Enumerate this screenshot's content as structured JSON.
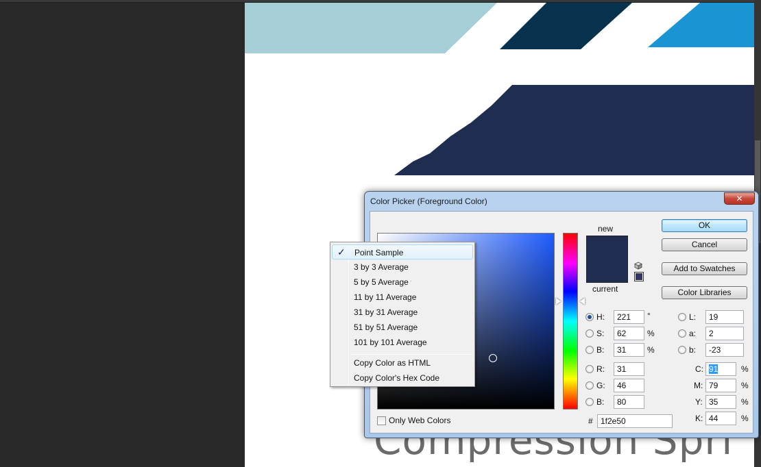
{
  "canvas": {
    "background_text": "Compression  Spri",
    "colors": {
      "light_teal": "#a6ced6",
      "dark_teal": "#06324e",
      "bright_blue": "#1a94d2",
      "navy": "#1f2e50"
    }
  },
  "dialog": {
    "title": "Color Picker (Foreground Color)",
    "close_glyph": "✕",
    "new_label": "new",
    "current_label": "current",
    "swatch_color": "#1f2e50",
    "buttons": {
      "ok": "OK",
      "cancel": "Cancel",
      "add_to_swatches": "Add to Swatches",
      "color_libraries": "Color Libraries"
    },
    "hsb": {
      "h_label": "H:",
      "h_value": "221",
      "h_unit": "°",
      "s_label": "S:",
      "s_value": "62",
      "s_unit": "%",
      "b_label": "B:",
      "b_value": "31",
      "b_unit": "%"
    },
    "rgb": {
      "r_label": "R:",
      "r_value": "31",
      "g_label": "G:",
      "g_value": "46",
      "b_label": "B:",
      "b_value": "80"
    },
    "lab": {
      "l_label": "L:",
      "l_value": "19",
      "a_label": "a:",
      "a_value": "2",
      "b_label": "b:",
      "b_value": "-23"
    },
    "cmyk": {
      "c_label": "C:",
      "c_value": "91",
      "m_label": "M:",
      "m_value": "79",
      "y_label": "Y:",
      "y_value": "35",
      "k_label": "K:",
      "k_value": "44",
      "unit": "%"
    },
    "hex_label": "#",
    "hex_value": "1f2e50",
    "only_web_colors_label": "Only Web Colors"
  },
  "context_menu": {
    "items": [
      {
        "label": "Point Sample",
        "checked": true
      },
      {
        "label": "3 by 3 Average"
      },
      {
        "label": "5 by 5 Average"
      },
      {
        "label": "11 by 11 Average"
      },
      {
        "label": "31 by 31 Average"
      },
      {
        "label": "51 by 51 Average"
      },
      {
        "label": "101 by 101 Average"
      },
      {
        "label": "Copy Color as HTML"
      },
      {
        "label": "Copy Color's Hex Code"
      }
    ],
    "check_glyph": "✓"
  }
}
